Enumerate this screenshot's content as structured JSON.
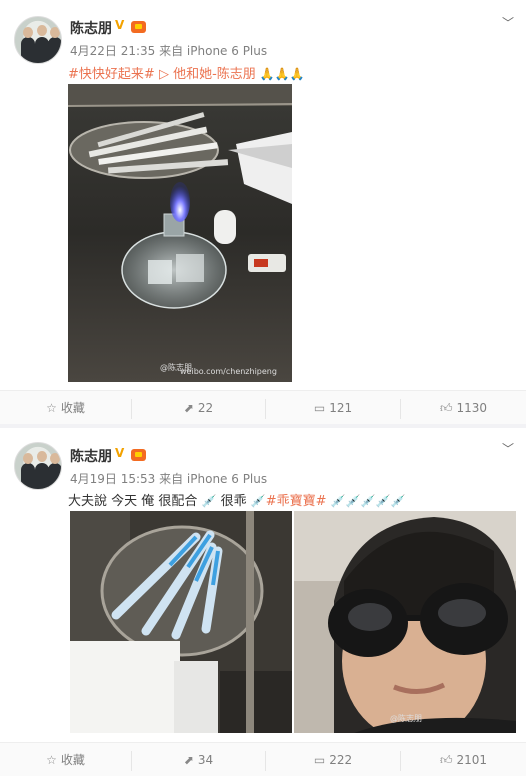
{
  "posts": [
    {
      "author": "陈志朋",
      "verified_badge": "V",
      "meta": "4月22日 21:35 来自 iPhone 6 Plus",
      "tag": "#快快好起来#",
      "video_link": "他和她-陈志朋",
      "emoji": "🙏🙏🙏",
      "watermark": "@陈志朋",
      "watermark_url": "weibo.com/chenzhipeng",
      "actions": {
        "collect": "收藏",
        "repost": "22",
        "comment": "121",
        "like": "1130"
      }
    },
    {
      "author": "陈志朋",
      "verified_badge": "V",
      "meta": "4月19日 15:53 来自 iPhone 6 Plus",
      "text1": "大夫說 今天 俺 很配合",
      "text2": "很乖",
      "tag": "#乖寶寶#",
      "watermark": "@陈志朋",
      "actions": {
        "collect": "收藏",
        "repost": "34",
        "comment": "222",
        "like": "2101"
      }
    }
  ],
  "icons": {
    "collect": "star-outline-icon",
    "repost": "repost-icon",
    "comment": "comment-icon",
    "like": "thumbs-up-icon",
    "caret": "chevron-down-icon",
    "video": "play-triangle-icon"
  }
}
